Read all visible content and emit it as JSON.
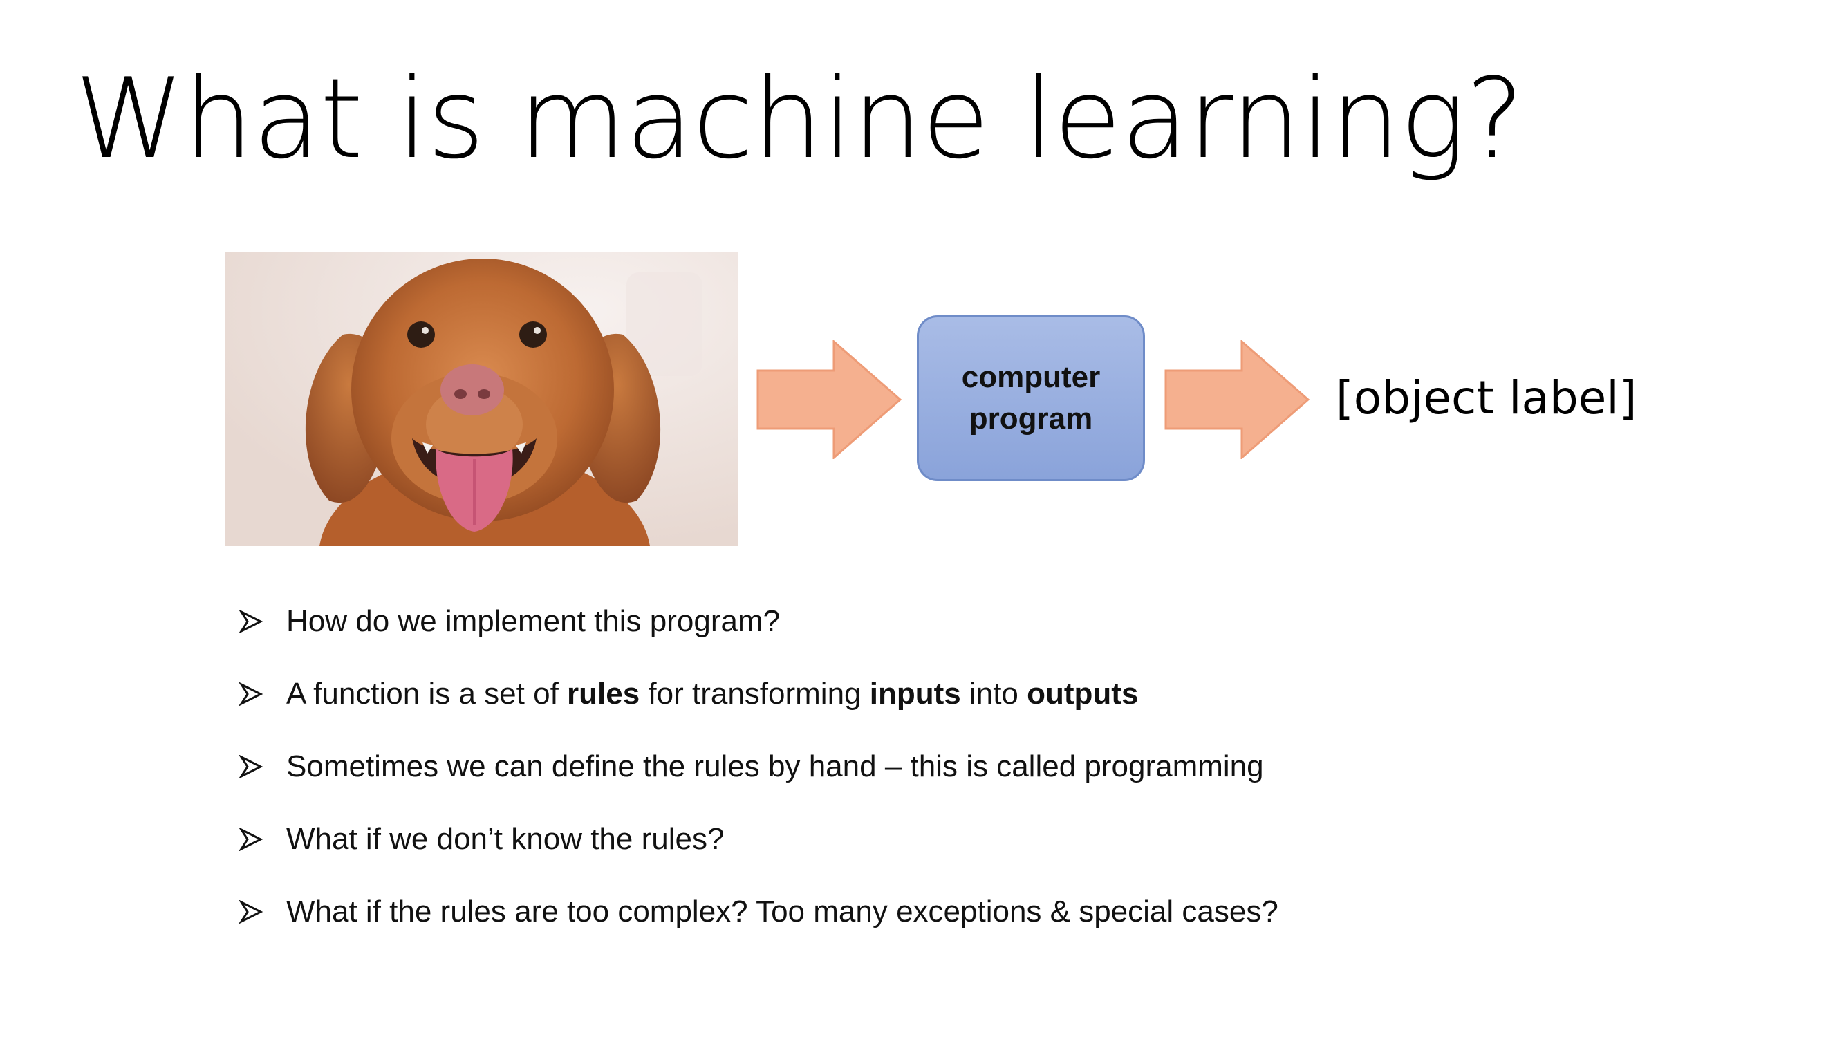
{
  "slide": {
    "title": "What is machine learning?",
    "program_box": {
      "line1": "computer",
      "line2": "program"
    },
    "object_label": "[object label]",
    "bullets": [
      {
        "segments": [
          {
            "text": "How do we implement this program?",
            "bold": false
          }
        ]
      },
      {
        "segments": [
          {
            "text": "A function is a set of ",
            "bold": false
          },
          {
            "text": "rules",
            "bold": true
          },
          {
            "text": " for transforming ",
            "bold": false
          },
          {
            "text": "inputs",
            "bold": true
          },
          {
            "text": " into ",
            "bold": false
          },
          {
            "text": "outputs",
            "bold": true
          }
        ]
      },
      {
        "segments": [
          {
            "text": "Sometimes we can define the rules by hand – this is called programming",
            "bold": false
          }
        ]
      },
      {
        "segments": [
          {
            "text": "What if we don’t know the rules?",
            "bold": false
          }
        ]
      },
      {
        "segments": [
          {
            "text": "What if the rules are too complex? Too many exceptions & special cases?",
            "bold": false
          }
        ]
      }
    ]
  },
  "colors": {
    "arrow_fill": "#f5b08f",
    "arrow_stroke": "#ee9c77",
    "box_fill_top": "#a9bce6",
    "box_fill_bottom": "#8aa3da",
    "box_border": "#6f8cc8",
    "dog_fur": "#b8662f"
  },
  "icons": {
    "bullet": "arrowhead-bullet-icon",
    "arrow": "right-block-arrow-icon"
  }
}
